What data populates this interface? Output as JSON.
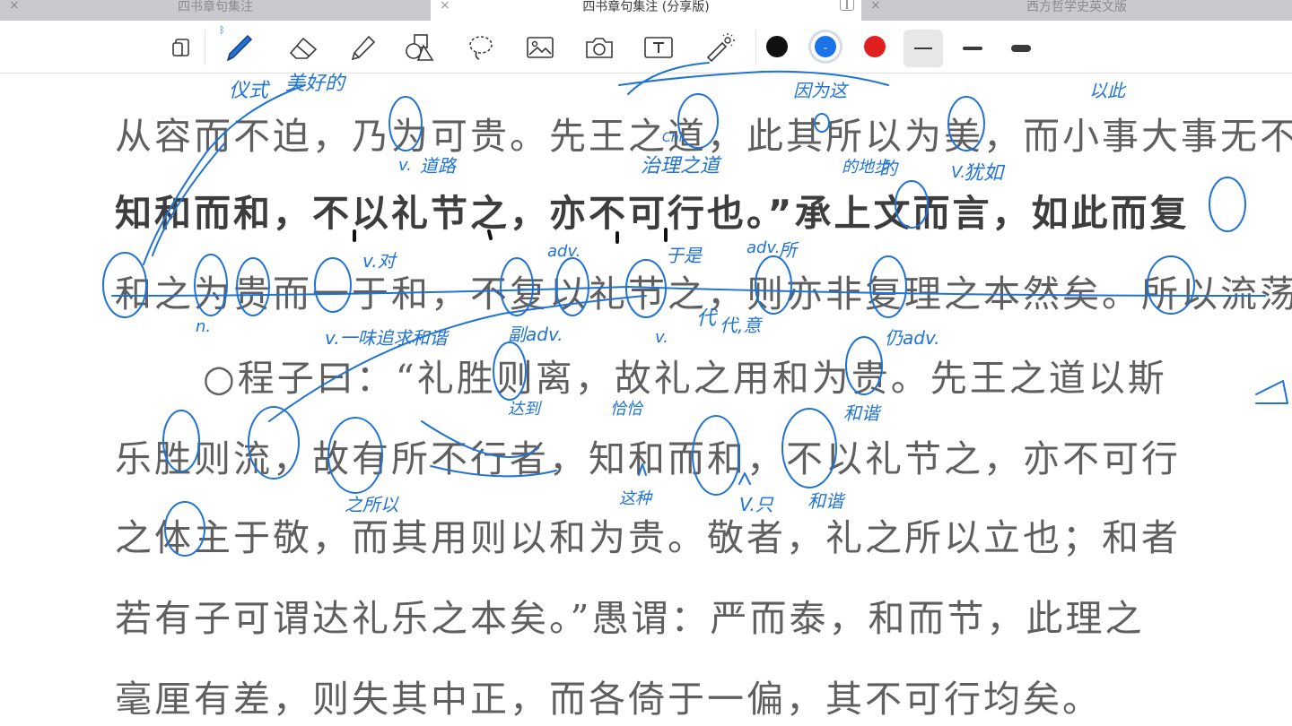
{
  "tabs": [
    {
      "title": "四书章句集注",
      "active": false
    },
    {
      "title": "四书章句集注 (分享版)",
      "active": true
    },
    {
      "title": "西方哲学史英文版",
      "active": false
    }
  ],
  "tab_close_glyph": "×",
  "toolbar": {
    "tools": [
      "page-view-icon",
      "pen-icon",
      "eraser-icon",
      "highlighter-icon",
      "shapes-icon",
      "lasso-icon",
      "image-icon",
      "camera-icon",
      "text-icon",
      "laser-pointer-icon"
    ],
    "bluetooth_glyph": "ᛒ",
    "colors": [
      "#111111",
      "#1a73e8",
      "#e02020"
    ],
    "selected_color": "#1a73e8",
    "selected_color_glyph": "⌄",
    "thickness_options": [
      "thin",
      "medium",
      "thick"
    ],
    "selected_thickness": "thin"
  },
  "document": {
    "lines": [
      {
        "text": "从容而不迫，乃为可贵。先王之道，此其所以为美，而小事大事无不",
        "bold": false
      },
      {
        "text": "知和而和，不以礼节之，亦不可行也。”承上文而言，如此而复",
        "bold": true
      },
      {
        "text": "和之为贵而一于和，不复以礼节之，则亦非复理之本然矣。所以流荡",
        "bold": false
      },
      {
        "text": "○程子曰：“礼胜则离，故礼之用和为贵。先王之道以斯",
        "bold": false
      },
      {
        "text": "乐胜则流，故有所不行者，知和而和，不以礼节之，亦不可行",
        "bold": false
      },
      {
        "text": "之体主于敬，而其用则以和为贵。敬者，礼之所以立也；和者",
        "bold": false
      },
      {
        "text": "若有子可谓达礼乐之本矣。”愚谓：严而泰，和而节，此理之",
        "bold": false
      },
      {
        "text": "毫厘有差，则失其中正，而各倚于一偏，其不可行均矣。",
        "bold": false
      }
    ]
  },
  "annotations": {
    "ink_color": "#1f73d6",
    "notes": [
      "仪式",
      "美好的",
      "v.",
      "道路",
      "因为这",
      "V.",
      "犹如",
      "的",
      "v.对",
      "adv.",
      "于是",
      "adv.",
      "所",
      "v.",
      "代",
      "n.",
      "v.一味追求和谐",
      "副adv.",
      "达到",
      "代,意",
      "恰恰",
      "仍adv.",
      "和谐",
      "这种",
      "V.只",
      "和谐",
      "Chi",
      "治理之道",
      "以此",
      "的地步",
      "之所以"
    ]
  }
}
